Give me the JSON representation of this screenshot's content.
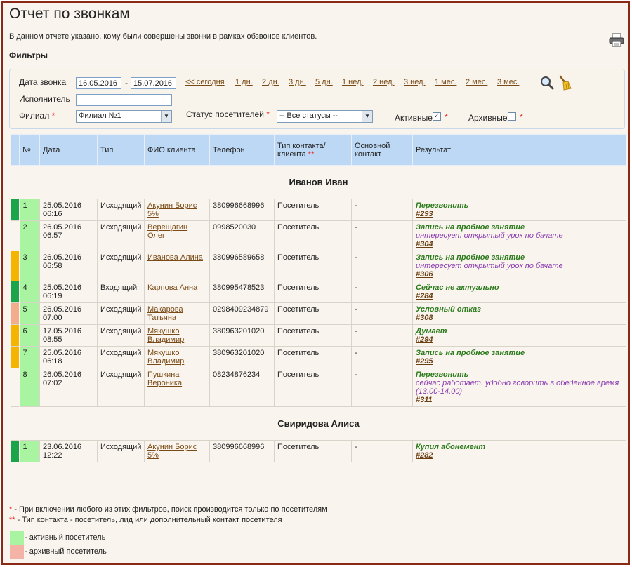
{
  "page": {
    "title": "Отчет по звонкам",
    "description": "В данном отчете указано, кому были совершены звонки в рамках обзвонов клиентов.",
    "filters_title": "Фильтры"
  },
  "filters": {
    "date_label": "Дата звонка",
    "date_from": "16.05.2016",
    "date_to": "15.07.2016",
    "date_sep": "-",
    "quick_links": [
      "<< сегодня",
      "1 дн.",
      "2 дн.",
      "3 дн.",
      "5 дн.",
      "1 нед.",
      "2 нед.",
      "3 нед.",
      "1 мес.",
      "2 мес.",
      "3 мес."
    ],
    "executor_label": "Исполнитель",
    "executor_value": "",
    "branch_label": "Филиал",
    "branch_value": "Филиал №1",
    "status_label": "Статус посетителей",
    "status_value": "-- Все статусы --",
    "active_label": "Активные",
    "active_checked": true,
    "archive_label": "Архивные",
    "archive_checked": false,
    "required_mark": "*"
  },
  "table": {
    "headers": [
      "№",
      "Дата",
      "Тип",
      "ФИО клиента",
      "Телефон",
      "Тип контакта/ клиента",
      "Основной контакт",
      "Результат"
    ],
    "header_mark": "**",
    "colors": {
      "green": "#1aa54a",
      "orange": "#f5b400",
      "salmon": "#f2ad8c",
      "active": "#a8f4a0",
      "archive": "#f3b3a6"
    },
    "groups": [
      {
        "name": "Иванов Иван",
        "rows": [
          {
            "ind": "#1aa54a",
            "num": "1",
            "date": "25.05.2016",
            "time": "06:16",
            "type": "Исходящий",
            "client": "Акунин Борис 5%",
            "phone": "380996668996",
            "ctype": "Посетитель",
            "main": "-",
            "result": "Перезвонить",
            "comment": "",
            "link": "#293"
          },
          {
            "ind": "",
            "num": "2",
            "date": "26.05.2016",
            "time": "06:57",
            "type": "Исходящий",
            "client": "Верещагин Олег",
            "phone": "0998520030",
            "ctype": "Посетитель",
            "main": "-",
            "result": "Запись на пробное занятие",
            "comment": "интересует открытый урок по бачате",
            "link": "#304"
          },
          {
            "ind": "#f5b400",
            "num": "3",
            "date": "26.05.2016",
            "time": "06:58",
            "type": "Исходящий",
            "client": "Иванова Алина",
            "phone": "380996589658",
            "ctype": "Посетитель",
            "main": "-",
            "result": "Запись на пробное занятие",
            "comment": "интересует открытый урок по бачате",
            "link": "#306"
          },
          {
            "ind": "#1aa54a",
            "num": "4",
            "date": "25.05.2016",
            "time": "06:19",
            "type": "Входящий",
            "client": "Карпова Анна",
            "phone": "380995478523",
            "ctype": "Посетитель",
            "main": "-",
            "result": "Сейчас не актуально",
            "comment": "",
            "link": "#284"
          },
          {
            "ind": "#f2ad8c",
            "num": "5",
            "date": "26.05.2016",
            "time": "07:00",
            "type": "Исходящий",
            "client": "Макарова Татьяна",
            "phone": "0298409234879",
            "ctype": "Посетитель",
            "main": "-",
            "result": "Условный отказ",
            "comment": "",
            "link": "#308"
          },
          {
            "ind": "#f5b400",
            "num": "6",
            "date": "17.05.2016",
            "time": "08:55",
            "type": "Исходящий",
            "client": "Мякушко Владимир",
            "phone": "380963201020",
            "ctype": "Посетитель",
            "main": "-",
            "result": "Думает",
            "comment": "",
            "link": "#294"
          },
          {
            "ind": "#f5b400",
            "num": "7",
            "date": "25.05.2016",
            "time": "06:18",
            "type": "Исходящий",
            "client": "Мякушко Владимир",
            "phone": "380963201020",
            "ctype": "Посетитель",
            "main": "-",
            "result": "Запись на пробное занятие",
            "comment": "",
            "link": "#295"
          },
          {
            "ind": "",
            "num": "8",
            "date": "26.05.2016",
            "time": "07:02",
            "type": "Исходящий",
            "client": "Пушкина Вероника",
            "phone": "08234876234",
            "ctype": "Посетитель",
            "main": "-",
            "result": "Перезвонить",
            "comment": "сейчас работает. удобно говорить в обеденное время (13.00-14.00)",
            "link": "#311"
          }
        ]
      },
      {
        "name": "Свиридова Алиса",
        "rows": [
          {
            "ind": "#1aa54a",
            "num": "1",
            "date": "23.06.2016",
            "time": "12:22",
            "type": "Исходящий",
            "client": "Акунин Борис 5%",
            "phone": "380996668996",
            "ctype": "Посетитель",
            "main": "-",
            "result": "Купил абонемент",
            "comment": "",
            "link": "#282"
          }
        ]
      }
    ]
  },
  "footnotes": {
    "note1_mark": "*",
    "note1": " - При включении любого из этих фильтров, поиск производится только по посетителям",
    "note2_mark": "**",
    "note2": " - Тип контакта - посетитель, лид или дополнительный контакт посетителя",
    "legend_active": "- активный посетитель",
    "legend_archive": "- архивный посетитель"
  },
  "icons": {
    "print": "printer-icon",
    "search": "magnifier-icon",
    "clear": "broom-icon"
  }
}
